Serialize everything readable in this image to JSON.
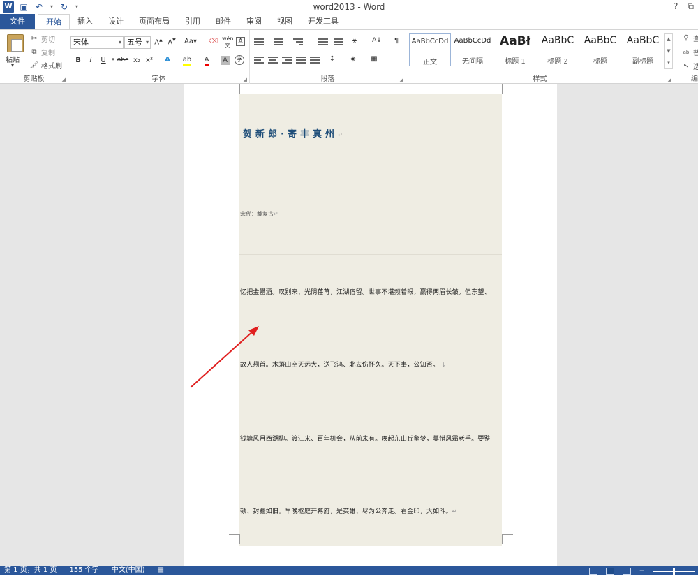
{
  "window": {
    "title": "word2013 - Word",
    "help": "?",
    "restore_label": "⧉"
  },
  "qat": {
    "save_icon": "save-icon",
    "undo_icon": "undo-icon",
    "redo_icon": "redo-icon"
  },
  "tabs": [
    {
      "label": "文件"
    },
    {
      "label": "开始"
    },
    {
      "label": "插入"
    },
    {
      "label": "设计"
    },
    {
      "label": "页面布局"
    },
    {
      "label": "引用"
    },
    {
      "label": "邮件"
    },
    {
      "label": "审阅"
    },
    {
      "label": "视图"
    },
    {
      "label": "开发工具"
    }
  ],
  "clipboard": {
    "paste": "粘贴",
    "cut": "剪切",
    "copy": "复制",
    "format_painter": "格式刷",
    "group": "剪贴板"
  },
  "font": {
    "name": "宋体",
    "size": "五号",
    "change_case": "Aa",
    "bold": "B",
    "italic": "I",
    "underline": "U",
    "strike": "abc",
    "sub": "x₂",
    "sup": "x²",
    "group": "字体"
  },
  "paragraph": {
    "group": "段落"
  },
  "styles": {
    "group": "样式",
    "items": [
      {
        "preview": "AaBbCcDd",
        "name": "正文"
      },
      {
        "preview": "AaBbCcDd",
        "name": "无间隔"
      },
      {
        "preview": "AaBł",
        "name": "标题 1"
      },
      {
        "preview": "AaBbC",
        "name": "标题 2"
      },
      {
        "preview": "AaBbC",
        "name": "标题"
      },
      {
        "preview": "AaBbC",
        "name": "副标题"
      }
    ]
  },
  "editing": {
    "group": "编",
    "find": "查",
    "replace": "替",
    "select": "选"
  },
  "document": {
    "title": "贺新郎·寄丰真州",
    "meta": "宋代：戴复古",
    "lines": [
      "忆把金罍酒。叹别来、光阴荏苒，江湖宿留。世事不堪频着眼，赢得两眉长皱。但东望、",
      "故人翘首。木落山空天远大，送飞鸿、北去伤怀久。天下事，公知否。",
      "钱塘风月西湖柳。渡江来、百年机会，从前未有。唤起东山丘壑梦，莫惜风霜老手。要整",
      "顿、封疆如旧。早晚枢庭开幕府，是英雄、尽为公奔走。看金印，大如斗。"
    ]
  },
  "status": {
    "page": "第 1 页，共 1 页",
    "words": "155 个字",
    "language": "中文(中国)"
  }
}
